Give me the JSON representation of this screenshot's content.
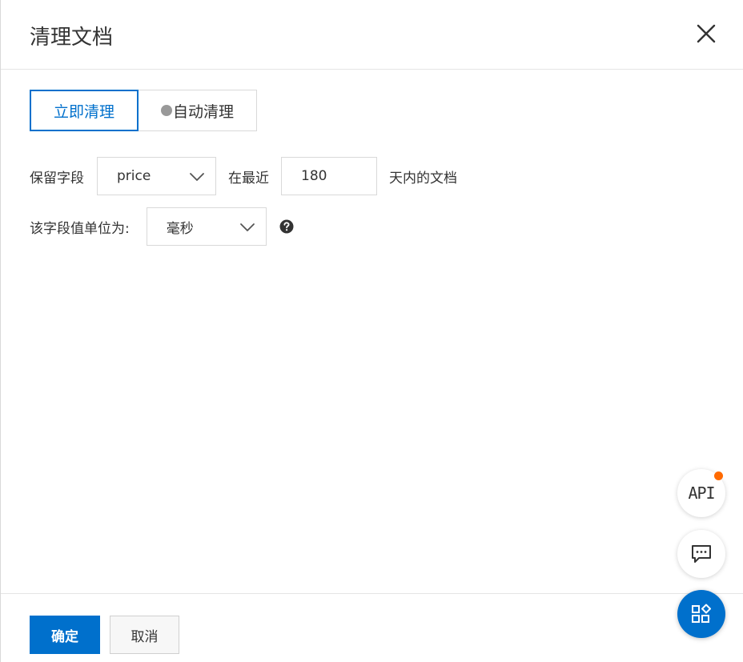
{
  "dialog": {
    "title": "清理文档"
  },
  "tabs": [
    {
      "label": "立即清理",
      "active": true
    },
    {
      "label": "自动清理",
      "active": false
    }
  ],
  "form": {
    "retain_field_label": "保留字段",
    "retain_field_value": "price",
    "within_recent_label": "在最近",
    "days_value": "180",
    "days_suffix": "天内的文档",
    "unit_label": "该字段值单位为:",
    "unit_value": "毫秒"
  },
  "footer": {
    "confirm_label": "确定",
    "cancel_label": "取消"
  },
  "floating": {
    "api_label": "API"
  },
  "colors": {
    "accent": "#0070cc",
    "badge": "#ff6a00",
    "inactive_dot": "#999999"
  },
  "icons": {
    "close": "close-icon",
    "chevron": "chevron-down-icon",
    "help": "help-circle-icon",
    "chat": "chat-icon",
    "apps": "apps-icon"
  }
}
